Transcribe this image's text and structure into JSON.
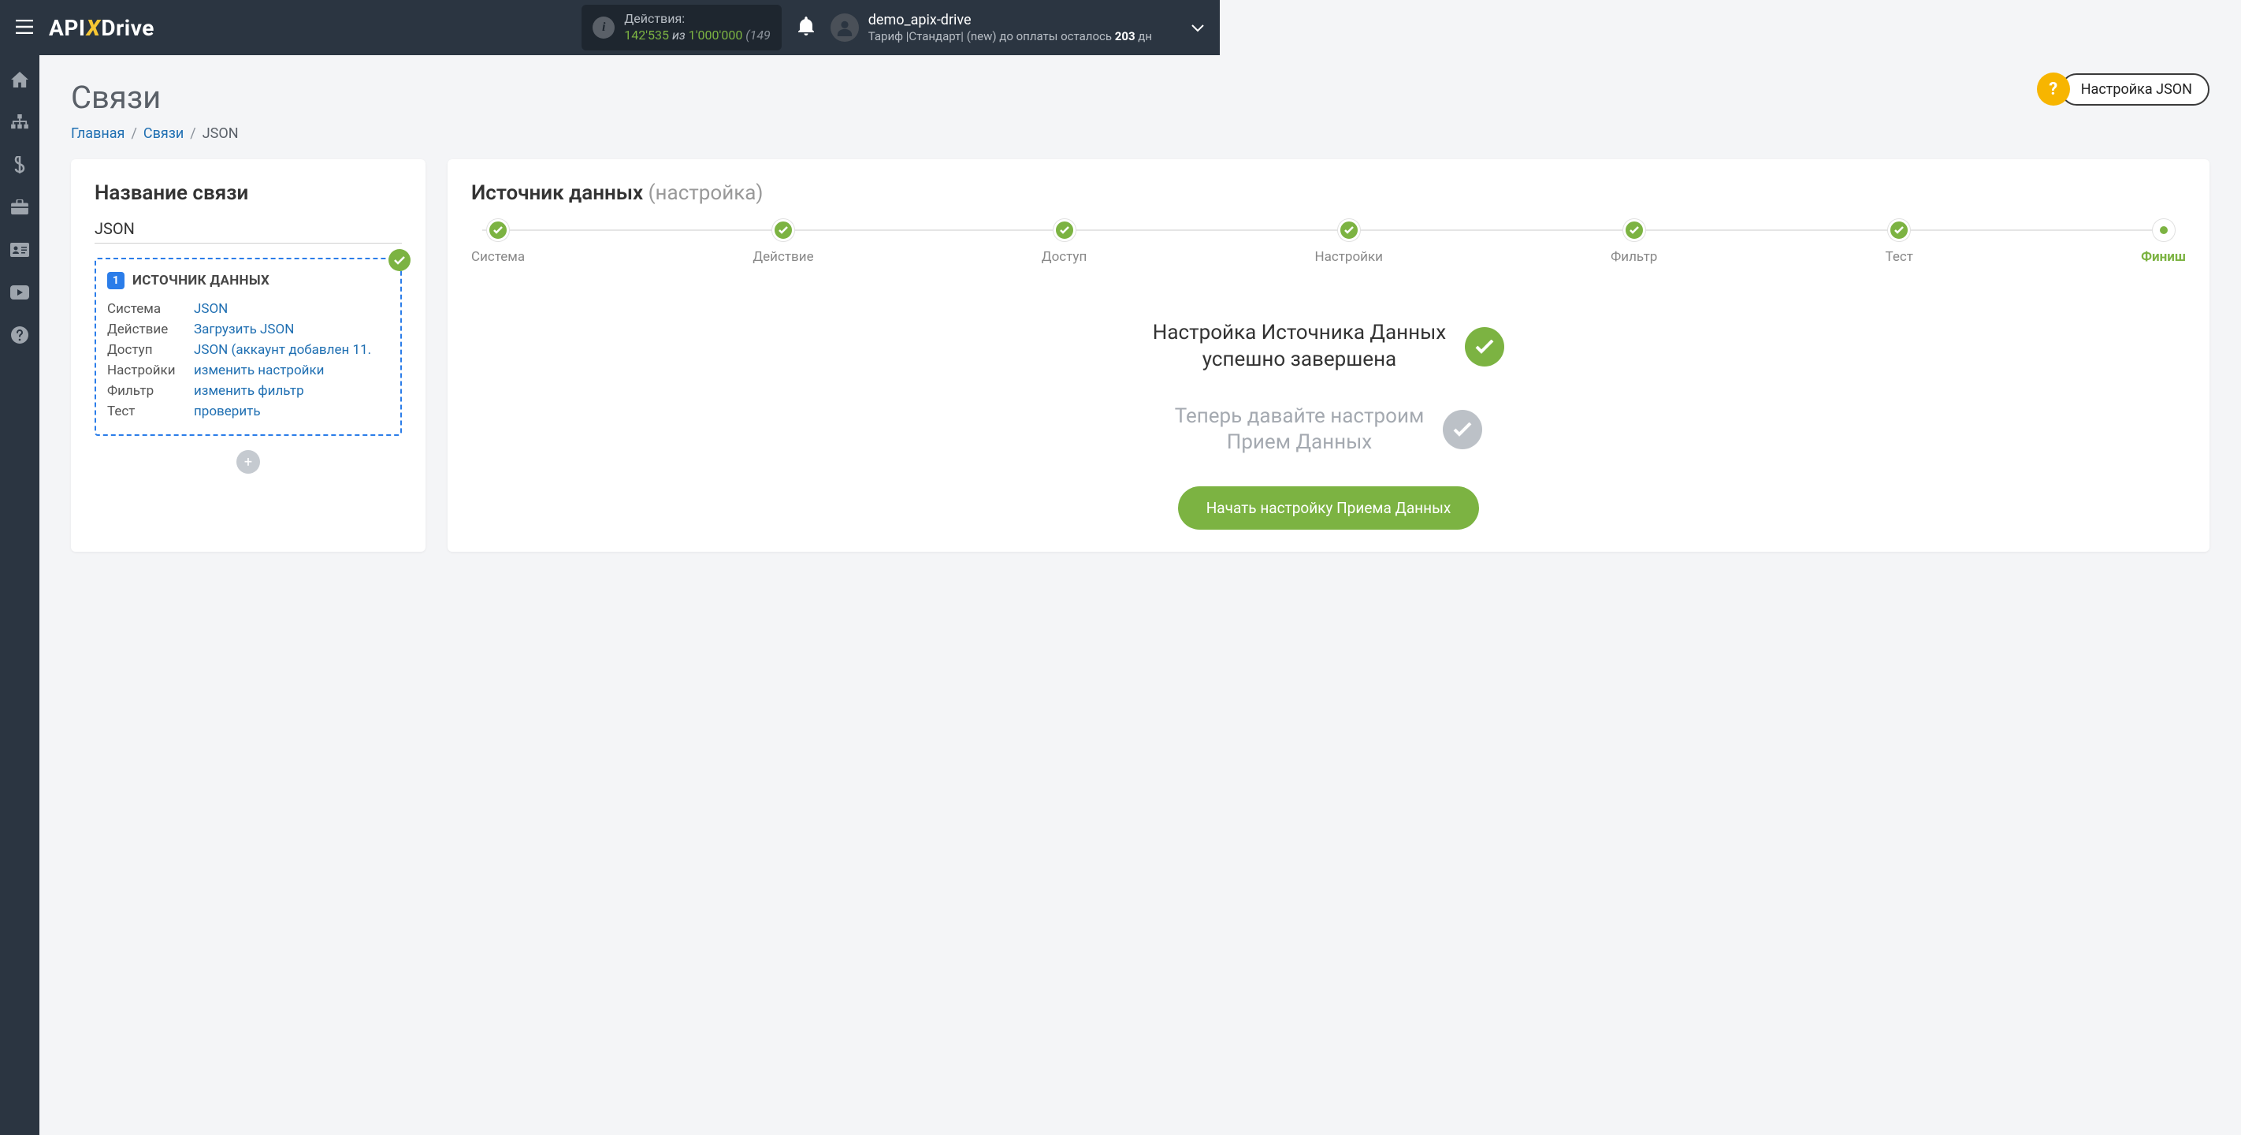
{
  "header": {
    "actions_label": "Действия:",
    "actions_used": "142'535",
    "actions_of": "из",
    "actions_total": "1'000'000",
    "actions_extra": "(149",
    "user_name": "demo_apix-drive",
    "plan_prefix": "Тариф |Стандарт| (new) до оплаты осталось ",
    "plan_days": "203",
    "plan_suffix": " дн"
  },
  "help": {
    "label": "Настройка JSON"
  },
  "page": {
    "title": "Связи",
    "breadcrumb_home": "Главная",
    "breadcrumb_links": "Связи",
    "breadcrumb_current": "JSON"
  },
  "left": {
    "title": "Название связи",
    "conn_name": "JSON",
    "source_title": "ИСТОЧНИК ДАННЫХ",
    "rows": [
      {
        "label": "Система",
        "value": "JSON"
      },
      {
        "label": "Действие",
        "value": "Загрузить JSON"
      },
      {
        "label": "Доступ",
        "value": "JSON (аккаунт добавлен 11."
      },
      {
        "label": "Настройки",
        "value": "изменить настройки"
      },
      {
        "label": "Фильтр",
        "value": "изменить фильтр"
      },
      {
        "label": "Тест",
        "value": "проверить"
      }
    ]
  },
  "right": {
    "title": "Источник данных",
    "subtitle": "(настройка)",
    "steps": [
      "Система",
      "Действие",
      "Доступ",
      "Настройки",
      "Фильтр",
      "Тест",
      "Финиш"
    ],
    "status1_l1": "Настройка Источника Данных",
    "status1_l2": "успешно завершена",
    "status2_l1": "Теперь давайте настроим",
    "status2_l2": "Прием Данных",
    "cta": "Начать настройку Приема Данных"
  }
}
